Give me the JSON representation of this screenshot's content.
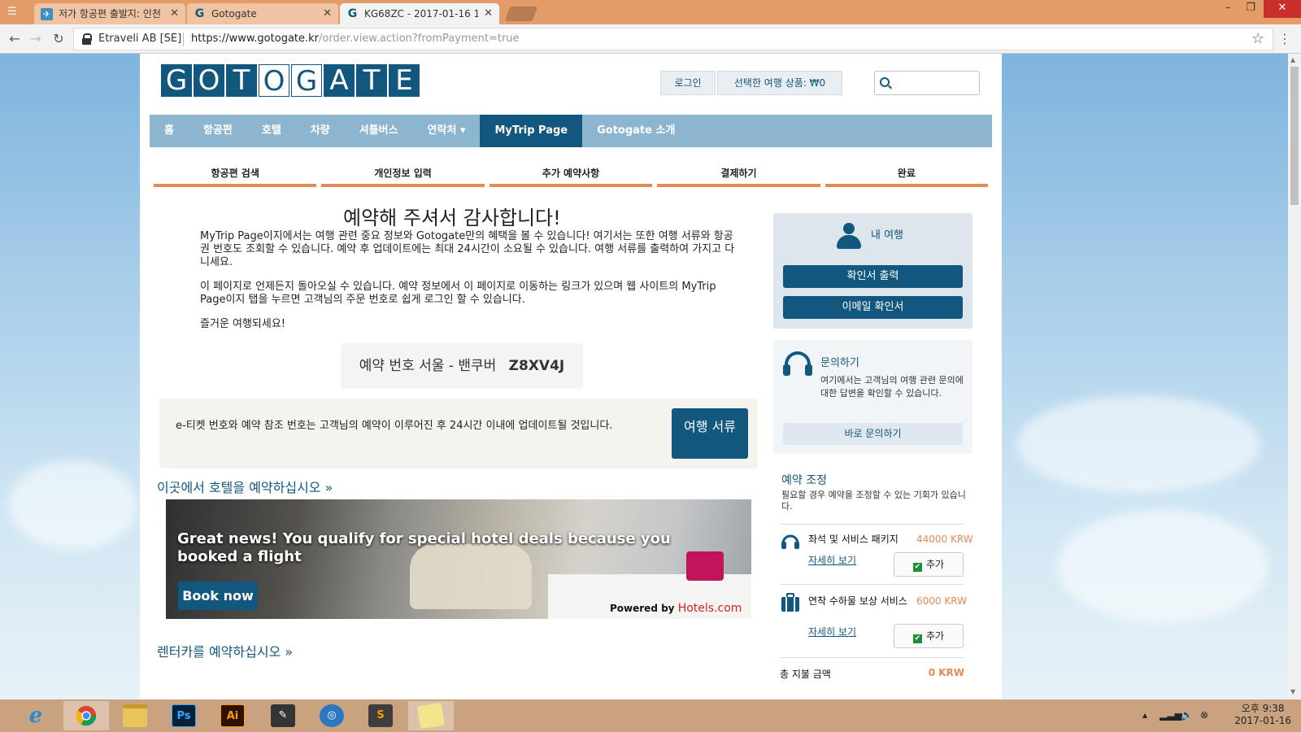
{
  "browser": {
    "tabs": [
      {
        "label": "저가 항공편 출발지: 인천",
        "favicon": "travel-site-icon",
        "favicon_color": "#3b8fc4"
      },
      {
        "label": "Gotogate",
        "favicon": "gotogate-g-icon",
        "favicon_color": "#12577d"
      },
      {
        "label": "KG68ZC - 2017-01-16 1",
        "favicon": "gotogate-g-icon",
        "favicon_color": "#12577d"
      }
    ],
    "active_tab": 2,
    "address": {
      "org": "Etraveli AB [SE]",
      "url_host": "https://www.gotogate.kr",
      "url_path": "/order.view.action?fromPayment=true"
    }
  },
  "site": {
    "logo_letters": [
      "G",
      "O",
      "T",
      "O",
      "G",
      "A",
      "T",
      "E"
    ],
    "header": {
      "login": "로그인",
      "cart": "선택한 여행 상품: ₩0",
      "search_placeholder": ""
    },
    "nav": [
      "홈",
      "항공편",
      "호텔",
      "차량",
      "셔틀버스",
      "연락처 ▾",
      "MyTrip Page",
      "Gotogate 소개"
    ],
    "nav_active": 6,
    "steps": [
      "항공편 검색",
      "개인정보 입력",
      "추가 예약사항",
      "결제하기",
      "완료"
    ]
  },
  "main": {
    "title": "예약해 주셔서 감사합니다!",
    "intro": "MyTrip Page이지에서는 여행 관련 중요 정보와 Gotogate만의 혜택을 볼 수 있습니다! 여기서는 또한 여행 서류와 항공권 번호도 조회할 수 있습니다. 예약 후 업데이트에는 최대 24시간이 소요될 수 있습니다. 여행 서류를 출력하여 가지고 다니세요.",
    "return_info": "이 페이지로 언제든지 돌아오실 수 있습니다. 예약 정보에서 이 페이지로 이동하는 링크가 있으며 웹 사이트의 MyTrip Page이지 탭을 누르면 고객님의 주문 번호로 쉽게 로그인 할 수 있습니다.",
    "enjoy": "즐거운 여행되세요!",
    "booking_ref_label": "예약 번호 서울 - 밴쿠버",
    "booking_ref_code": "Z8XV4J",
    "ticket_notice": "e-티켓 번호와 예약 참조 번호는 고객님의 예약이 이루어진 후 24시간 이내에 업데이트될 것입니다.",
    "travel_docs_button": "여행 서류",
    "hotel_link": "이곳에서 호텔을 예약하십시오 »",
    "banner": {
      "headline": "Great news! You qualify for special hotel deals because you booked a flight",
      "cta": "Book now",
      "powered_by": "Powered by",
      "brand": "Hotels.com"
    },
    "car_link": "렌터카를 예약하십시오 »"
  },
  "sidebar": {
    "mytrip": {
      "title": "내 여행",
      "print_button": "확인서 출력",
      "email_button": "이메일 확인서"
    },
    "contact": {
      "title": "문의하기",
      "desc": "여기에서는 고객님의 여행 관련 문의에 대한 답변을 확인할 수 있습니다.",
      "button": "바로 문의하기"
    },
    "adjust": {
      "title": "예약 조정",
      "desc": "필요할 경우 예약을 조정할 수 있는 기회가 있습니다.",
      "addons": [
        {
          "name": "좌석 및 서비스 패키지",
          "price": "44000 KRW",
          "more": "자세히 보기",
          "add": "추가",
          "icon": "headset-icon"
        },
        {
          "name": "연착 수하물 보상 서비스",
          "price": "6000 KRW",
          "more": "자세히 보기",
          "add": "추가",
          "icon": "luggage-icon"
        }
      ],
      "total_label": "총 지불 금액",
      "total_value": "0 KRW"
    }
  },
  "taskbar": {
    "apps": [
      "internet-explorer-icon",
      "chrome-icon",
      "file-explorer-icon",
      "photoshop-icon",
      "illustrator-icon",
      "app-icon",
      "app-icon",
      "sublime-text-icon",
      "app-icon"
    ],
    "ps_label": "Ps",
    "ai_label": "Ai",
    "s_label": "S",
    "time": "오후 9:38",
    "date": "2017-01-16"
  },
  "colors": {
    "brand": "#12577d",
    "accent": "#e58a55",
    "nav_bg": "#8cb5cf"
  }
}
